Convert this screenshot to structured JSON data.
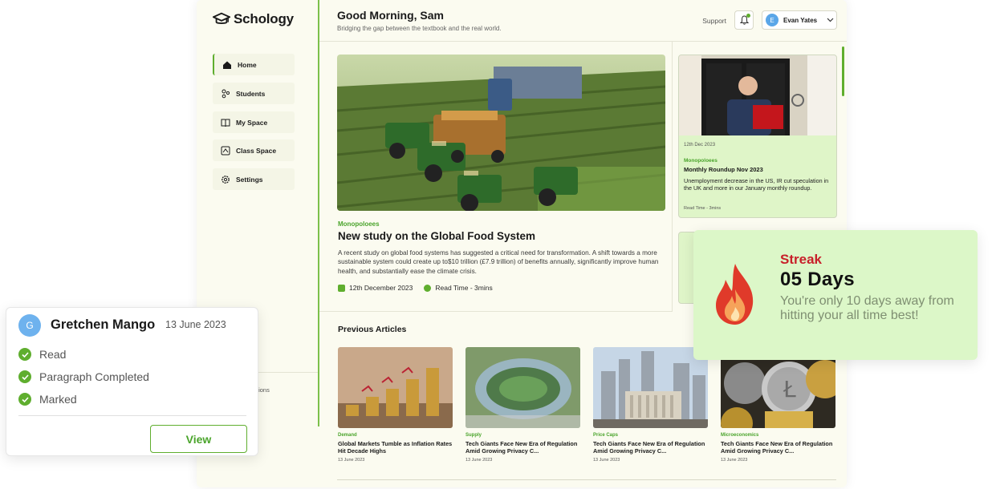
{
  "app": {
    "logo_text": "Schology"
  },
  "sidebar": {
    "items": [
      {
        "label": "Home",
        "icon": "home-icon"
      },
      {
        "label": "Students",
        "icon": "students-icon"
      },
      {
        "label": "My Space",
        "icon": "book-icon"
      },
      {
        "label": "Class Space",
        "icon": "class-space-icon"
      },
      {
        "label": "Settings",
        "icon": "gear-icon"
      }
    ],
    "bottom_label": "tions"
  },
  "header": {
    "greeting": "Good Morning, Sam",
    "subtitle": "Bridging the gap between the textbook and the real world.",
    "support": "Support",
    "user_initial": "E",
    "user_name": "Evan Yates"
  },
  "hero": {
    "tag": "Monopoloees",
    "title": "New study on the Global Food System",
    "description": "A recent study on global food systems has suggested a critical need for transformation. A shift towards a more sustainable system could create up to$10 trillion (£7.9 trillion) of benefits annually, significantly improve human health, and substantially ease the climate crisis.",
    "date": "12th December 2023",
    "read_time": "Read Time - 3mins"
  },
  "side_card": {
    "date": "12th Dec 2023",
    "tag": "Monopoloees",
    "title": "Monthly Roundup Nov 2023",
    "description": "Unemployment decrease in the US, IR cut speculation in the UK and more in our January monthly roundup.",
    "read_time": "Read Time - 3mins"
  },
  "previous": {
    "heading": "Previous Articles",
    "articles": [
      {
        "tag": "Demand",
        "title": "Global Markets Tumble as Inflation Rates Hit Decade Highs",
        "date": "13 June 2023"
      },
      {
        "tag": "Supply",
        "title": "Tech Giants Face New Era of Regulation Amid Growing Privacy C...",
        "date": "13 June 2023"
      },
      {
        "tag": "Price Caps",
        "title": "Tech Giants Face New Era of Regulation Amid Growing Privacy C...",
        "date": "13 June 2023"
      },
      {
        "tag": "Microeconomics",
        "title": "Tech Giants Face New Era of Regulation Amid Growing Privacy C...",
        "date": "13 June 2023"
      }
    ]
  },
  "streak": {
    "label": "Streak",
    "days": "05 Days",
    "description": "You're only 10 days away from hitting your all time best!"
  },
  "student": {
    "initial": "G",
    "name": "Gretchen Mango",
    "date": "13 June 2023",
    "checks": [
      "Read",
      "Paragraph Completed",
      "Marked"
    ],
    "view_label": "View"
  },
  "colors": {
    "accent": "#5fae2e",
    "streak_red": "#c8202a",
    "card_green": "#dcf7c8",
    "background": "#fbfbf0"
  }
}
